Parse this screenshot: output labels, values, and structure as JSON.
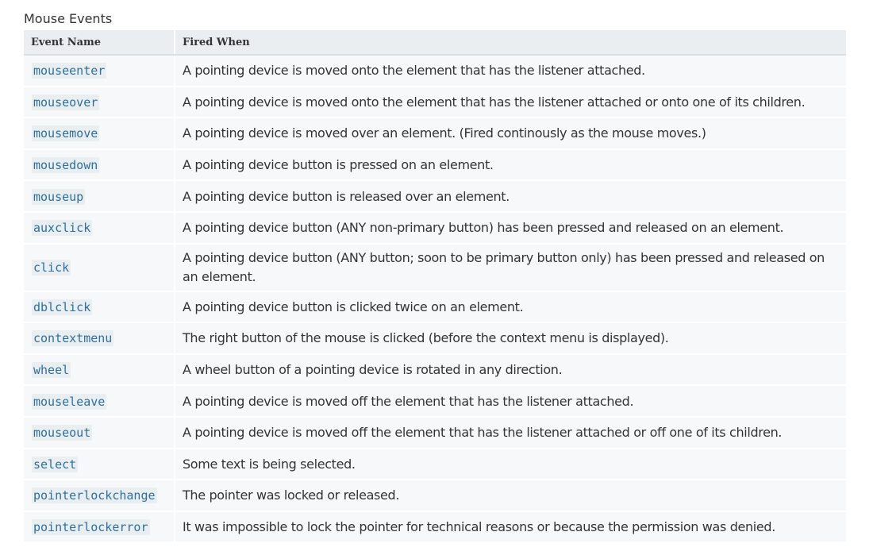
{
  "section": {
    "caption": "Mouse Events"
  },
  "table": {
    "headers": {
      "name": "Event Name",
      "fired": "Fired When"
    },
    "rows": [
      {
        "name": "mouseenter",
        "desc": "A pointing device is moved onto the element that has the listener attached."
      },
      {
        "name": "mouseover",
        "desc": "A pointing device is moved onto the element that has the listener attached or onto one of its children."
      },
      {
        "name": "mousemove",
        "desc": "A pointing device is moved over an element. (Fired continously as the mouse moves.)"
      },
      {
        "name": "mousedown",
        "desc": "A pointing device button is pressed on an element."
      },
      {
        "name": "mouseup",
        "desc": "A pointing device button is released over an element."
      },
      {
        "name": "auxclick",
        "desc": "A pointing device button (ANY non-primary button) has been pressed and released on an element."
      },
      {
        "name": "click",
        "desc": "A pointing device button (ANY button; soon to be primary button only) has been pressed and released on an element."
      },
      {
        "name": "dblclick",
        "desc": "A pointing device button is clicked twice on an element."
      },
      {
        "name": "contextmenu",
        "desc": "The right button of the mouse is clicked (before the context menu is displayed)."
      },
      {
        "name": "wheel",
        "desc": "A wheel button of a pointing device is rotated in any direction."
      },
      {
        "name": "mouseleave",
        "desc": "A pointing device is moved off the element that has the listener attached."
      },
      {
        "name": "mouseout",
        "desc": "A pointing device is moved off the element that has the listener attached or off one of its children."
      },
      {
        "name": "select",
        "desc": "Some text is being selected."
      },
      {
        "name": "pointerlockchange",
        "desc": "The pointer was locked or released."
      },
      {
        "name": "pointerlockerror",
        "desc": "It was impossible to lock the pointer for technical reasons or because the permission was denied."
      }
    ]
  },
  "colors": {
    "header_bg": "#eaeef0",
    "row_bg": "#f6f8f9",
    "code_text": "#2f6f9f",
    "code_bg": "#e9eef1",
    "text": "#333333"
  }
}
